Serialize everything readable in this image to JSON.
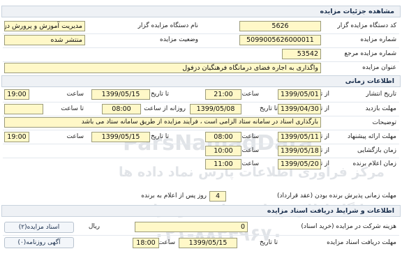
{
  "sections": {
    "details": "مشاهده جزئیات مزایده",
    "timing": "اطلاعات زمانی",
    "conditions": "اطلاعات و شرایط دریافت اسناد مزایده"
  },
  "details": {
    "org_code_label": "کد دستگاه مزایده گزار",
    "org_code": "5626",
    "org_name_label": "نام دستگاه مزایده گزار",
    "org_name": "مدیریت آموزش و پرورش دزفول",
    "auction_no_label": "شماره مزایده",
    "auction_no": "5099005626000011",
    "status_label": "وضعیت مزایده",
    "status": "منتشر شده",
    "ref_no_label": "شماره مزایده مرجع",
    "ref_no": "53542",
    "title_label": "عنوان مزایده",
    "title": "واگذاری به اجاره فضای درمانگاه فرهنگیان دزفول"
  },
  "timing": {
    "publish": {
      "label": "تاریخ انتشار",
      "from_label": "از تاریخ",
      "from_date": "1399/05/01",
      "from_time_label": "ساعت",
      "from_time": "21:00",
      "to_label": "تا تاریخ",
      "to_date": "1399/05/15",
      "to_time_label": "ساعت",
      "to_time": "19:00"
    },
    "visit": {
      "label": "مهلت بازدید",
      "from_label": "از تاریخ",
      "from_date": "1399/04/30",
      "to_label": "تا تاریخ",
      "to_date": "1399/05/08",
      "daily_label": "روزانه از ساعت",
      "daily_from": "08:00",
      "daily_to_label": "تا ساعت",
      "daily_to": ""
    },
    "notes_label": "توضیحات",
    "notes": "بارگذاری اسناد در سامانه ستاد الزامی است ، فرآیند مزایده از طریق سامانه ستاد می باشد",
    "offer": {
      "label": "مهلت ارائه پیشنهاد",
      "from_label": "از تاریخ",
      "from_date": "1399/05/11",
      "from_time_label": "ساعت",
      "from_time": "08:00",
      "to_label": "تا تاریخ",
      "to_date": "1399/05/15",
      "to_time_label": "ساعت",
      "to_time": "19:00"
    },
    "opening": {
      "label": "زمان بازگشایی",
      "from_label": "از تاریخ",
      "date": "1399/05/18",
      "time_label": "ساعت",
      "time": "10:00"
    },
    "winner": {
      "label": "زمان اعلام برنده",
      "from_label": "از تاریخ",
      "date": "1399/05/20",
      "time_label": "ساعت",
      "time": "11:00"
    },
    "acceptance_label": "مهلت زمانی پذیرش برنده بودن (عقد قرارداد)",
    "acceptance_days": "4",
    "acceptance_suffix": "روز پس از اعلام به برنده"
  },
  "conditions": {
    "fee_label": "هزینه شرکت در مزایده (خرید اسناد)",
    "fee": "0",
    "fee_unit": "ریال",
    "deadline_label": "مهلت دریافت اسناد مزایده",
    "deadline_to_label": "تا تاریخ",
    "deadline_date": "1399/05/15",
    "deadline_time_label": "ساعت",
    "deadline_time": "18:00"
  },
  "buttons": {
    "docs": "اسناد مزایده(۲)",
    "newspaper": "آگهی روزنامه(۰)"
  },
  "watermark": {
    "brand": "ParsNamadData",
    "line1": "مرکز فراوری اطلاعات پارس نماد داده ها",
    "line2": "پایگاه اطلاع رسانی مناقصه و مزایده",
    "phone": "۰۲۱-۸۸۳۴۹۶۷۰"
  }
}
